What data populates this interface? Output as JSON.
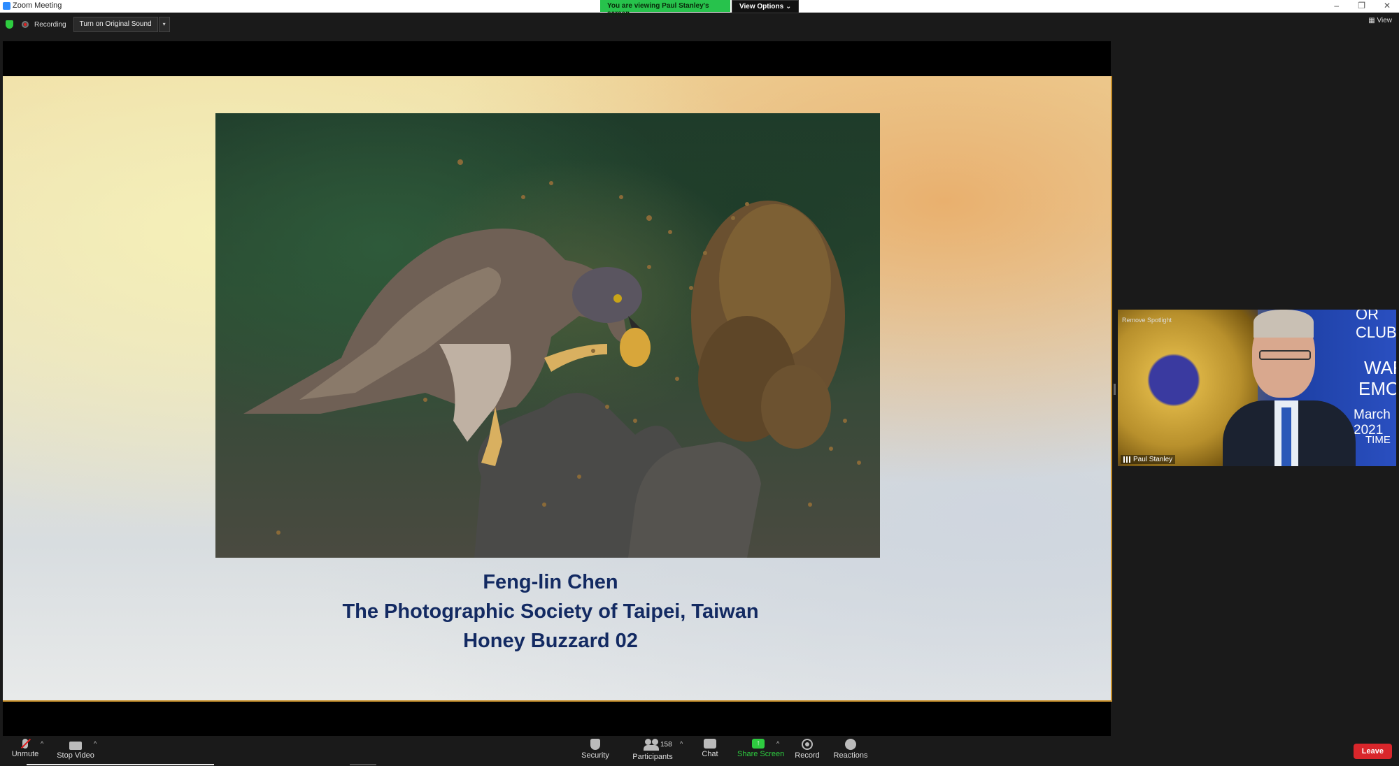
{
  "window": {
    "title": "Zoom Meeting"
  },
  "banner": {
    "viewing_text": "You are viewing Paul Stanley's screen",
    "view_options_label": "View Options ⌄"
  },
  "window_controls": {
    "minimize": "–",
    "restore": "❐",
    "close": "✕"
  },
  "topbar": {
    "recording_label": "Recording",
    "original_sound_label": "Turn on Original Sound",
    "view_label": "View",
    "dropdown_glyph": "▾"
  },
  "slide": {
    "caption_lines": [
      "Feng-lin Chen",
      "The Photographic Society of Taipei, Taiwan",
      "Honey Buzzard 02"
    ]
  },
  "video_tile": {
    "spotlight_label": "Remove Spotlight",
    "participant_name": "Paul Stanley",
    "background_text": [
      "OR CLUBS",
      "WARD",
      "EMONY",
      "March 2021",
      "TIME"
    ]
  },
  "toolbar": {
    "items": [
      {
        "label": "Unmute",
        "icon": "microphone-muted-icon"
      },
      {
        "label": "Stop Video",
        "icon": "video-camera-icon"
      },
      {
        "label": "Security",
        "icon": "shield-icon"
      },
      {
        "label": "Participants",
        "icon": "participants-icon"
      },
      {
        "label": "Chat",
        "icon": "chat-bubble-icon"
      },
      {
        "label": "Share Screen",
        "icon": "share-screen-icon"
      },
      {
        "label": "Record",
        "icon": "record-icon"
      },
      {
        "label": "Reactions",
        "icon": "reactions-icon"
      }
    ],
    "participants_count": "158",
    "caret": "^",
    "leave_label": "Leave",
    "share_glyph": "↑"
  },
  "colors": {
    "share_green": "#2ecc40",
    "leave_red": "#d9262b",
    "caption_navy": "#132a62",
    "banner_green": "#27c24c"
  }
}
